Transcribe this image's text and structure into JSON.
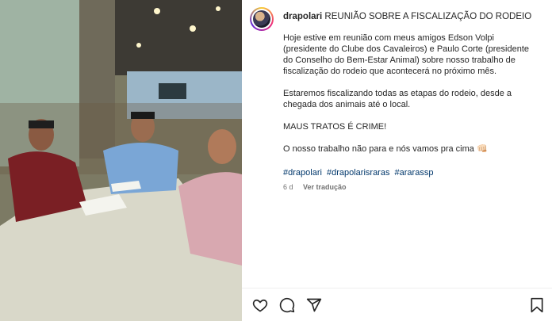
{
  "post": {
    "username": "drapolari",
    "title": "REUNIÃO SOBRE A FISCALIZAÇÃO DO RODEIO",
    "paragraph_1": "Hoje estive em reunião com meus amigos Edson Volpi (presidente do Clube dos Cavaleiros) e Paulo Corte (presidente do Conselho do Bem-Estar Animal) sobre nosso trabalho de fiscalização do rodeio que acontecerá no próximo mês.",
    "paragraph_2": "Estaremos fiscalizando todas as etapas do rodeio, desde a chegada dos animais até o local.",
    "paragraph_3": "MAUS TRATOS É CRIME!",
    "paragraph_4": "O nosso trabalho não para e nós vamos pra cima 👊🏻",
    "hashtags": [
      "#drapolari",
      "#drapolarisraras",
      "#ararassp"
    ],
    "age": "6 d",
    "translate_label": "Ver tradução"
  },
  "actions": {
    "like_icon": "heart-icon",
    "comment_icon": "comment-icon",
    "share_icon": "share-icon",
    "save_icon": "bookmark-icon"
  }
}
